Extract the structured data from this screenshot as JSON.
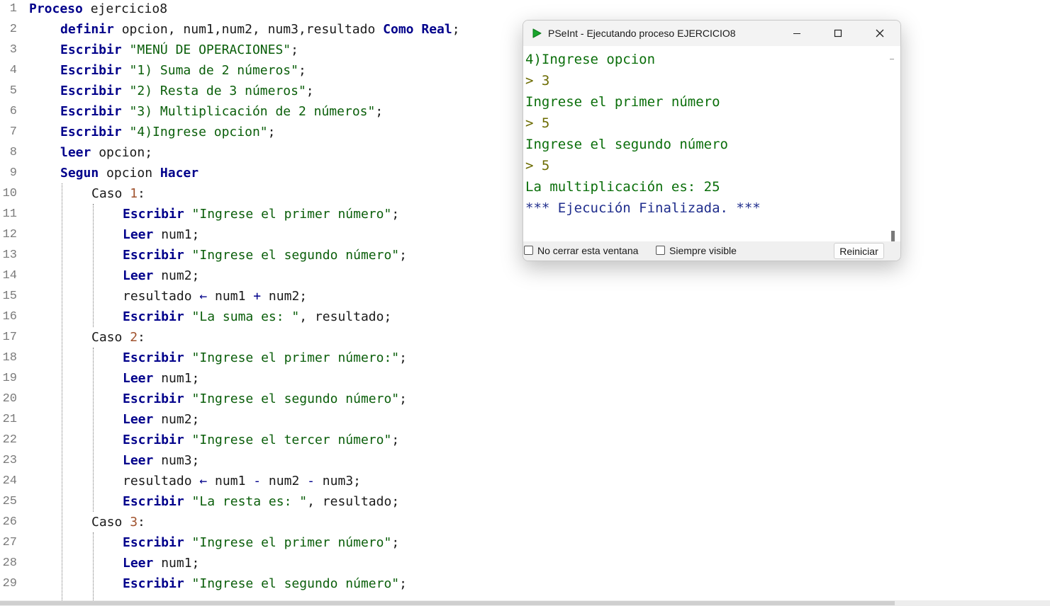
{
  "editor": {
    "lines": [
      {
        "n": "1",
        "indent": 0,
        "tokens": [
          {
            "t": "Proceso",
            "c": "kw"
          },
          {
            "t": " ejercicio8",
            "c": ""
          }
        ]
      },
      {
        "n": "2",
        "indent": 1,
        "tokens": [
          {
            "t": "definir",
            "c": "kw"
          },
          {
            "t": " opcion, num1,num2, num3,resultado ",
            "c": ""
          },
          {
            "t": "Como",
            "c": "kw"
          },
          {
            "t": " ",
            "c": ""
          },
          {
            "t": "Real",
            "c": "kw"
          },
          {
            "t": ";",
            "c": ""
          }
        ]
      },
      {
        "n": "3",
        "indent": 1,
        "tokens": [
          {
            "t": "Escribir",
            "c": "kw"
          },
          {
            "t": " ",
            "c": ""
          },
          {
            "t": "\"MENÚ DE OPERACIONES\"",
            "c": "str"
          },
          {
            "t": ";",
            "c": ""
          }
        ]
      },
      {
        "n": "4",
        "indent": 1,
        "tokens": [
          {
            "t": "Escribir",
            "c": "kw"
          },
          {
            "t": " ",
            "c": ""
          },
          {
            "t": "\"1) Suma de 2 números\"",
            "c": "str"
          },
          {
            "t": ";",
            "c": ""
          }
        ]
      },
      {
        "n": "5",
        "indent": 1,
        "tokens": [
          {
            "t": "Escribir",
            "c": "kw"
          },
          {
            "t": " ",
            "c": ""
          },
          {
            "t": "\"2) Resta de 3 números\"",
            "c": "str"
          },
          {
            "t": ";",
            "c": ""
          }
        ]
      },
      {
        "n": "6",
        "indent": 1,
        "tokens": [
          {
            "t": "Escribir",
            "c": "kw"
          },
          {
            "t": " ",
            "c": ""
          },
          {
            "t": "\"3) Multiplicación de 2 números\"",
            "c": "str"
          },
          {
            "t": ";",
            "c": ""
          }
        ]
      },
      {
        "n": "7",
        "indent": 1,
        "tokens": [
          {
            "t": "Escribir",
            "c": "kw"
          },
          {
            "t": " ",
            "c": ""
          },
          {
            "t": "\"4)Ingrese opcion\"",
            "c": "str"
          },
          {
            "t": ";",
            "c": ""
          }
        ]
      },
      {
        "n": "8",
        "indent": 1,
        "tokens": [
          {
            "t": "leer",
            "c": "kw"
          },
          {
            "t": " opcion;",
            "c": ""
          }
        ]
      },
      {
        "n": "9",
        "indent": 1,
        "tokens": [
          {
            "t": "Segun",
            "c": "kw"
          },
          {
            "t": " opcion ",
            "c": ""
          },
          {
            "t": "Hacer",
            "c": "kw"
          }
        ]
      },
      {
        "n": "10",
        "indent": 2,
        "tokens": [
          {
            "t": "Caso ",
            "c": ""
          },
          {
            "t": "1",
            "c": "num"
          },
          {
            "t": ":",
            "c": ""
          }
        ]
      },
      {
        "n": "11",
        "indent": 3,
        "tokens": [
          {
            "t": "Escribir",
            "c": "kw"
          },
          {
            "t": " ",
            "c": ""
          },
          {
            "t": "\"Ingrese el primer número\"",
            "c": "str"
          },
          {
            "t": ";",
            "c": ""
          }
        ]
      },
      {
        "n": "12",
        "indent": 3,
        "tokens": [
          {
            "t": "Leer",
            "c": "kw"
          },
          {
            "t": " num1;",
            "c": ""
          }
        ]
      },
      {
        "n": "13",
        "indent": 3,
        "tokens": [
          {
            "t": "Escribir",
            "c": "kw"
          },
          {
            "t": " ",
            "c": ""
          },
          {
            "t": "\"Ingrese el segundo número\"",
            "c": "str"
          },
          {
            "t": ";",
            "c": ""
          }
        ]
      },
      {
        "n": "14",
        "indent": 3,
        "tokens": [
          {
            "t": "Leer",
            "c": "kw"
          },
          {
            "t": " num2;",
            "c": ""
          }
        ]
      },
      {
        "n": "15",
        "indent": 3,
        "tokens": [
          {
            "t": "resultado ",
            "c": ""
          },
          {
            "t": "←",
            "c": "op"
          },
          {
            "t": " num1 ",
            "c": ""
          },
          {
            "t": "+",
            "c": "op"
          },
          {
            "t": " num2;",
            "c": ""
          }
        ]
      },
      {
        "n": "16",
        "indent": 3,
        "tokens": [
          {
            "t": "Escribir",
            "c": "kw"
          },
          {
            "t": " ",
            "c": ""
          },
          {
            "t": "\"La suma es: \"",
            "c": "str"
          },
          {
            "t": ", resultado;",
            "c": ""
          }
        ]
      },
      {
        "n": "17",
        "indent": 2,
        "tokens": [
          {
            "t": "Caso ",
            "c": ""
          },
          {
            "t": "2",
            "c": "num"
          },
          {
            "t": ":",
            "c": ""
          }
        ]
      },
      {
        "n": "18",
        "indent": 3,
        "tokens": [
          {
            "t": "Escribir",
            "c": "kw"
          },
          {
            "t": " ",
            "c": ""
          },
          {
            "t": "\"Ingrese el primer número:\"",
            "c": "str"
          },
          {
            "t": ";",
            "c": ""
          }
        ]
      },
      {
        "n": "19",
        "indent": 3,
        "tokens": [
          {
            "t": "Leer",
            "c": "kw"
          },
          {
            "t": " num1;",
            "c": ""
          }
        ]
      },
      {
        "n": "20",
        "indent": 3,
        "tokens": [
          {
            "t": "Escribir",
            "c": "kw"
          },
          {
            "t": " ",
            "c": ""
          },
          {
            "t": "\"Ingrese el segundo número\"",
            "c": "str"
          },
          {
            "t": ";",
            "c": ""
          }
        ]
      },
      {
        "n": "21",
        "indent": 3,
        "tokens": [
          {
            "t": "Leer",
            "c": "kw"
          },
          {
            "t": " num2;",
            "c": ""
          }
        ]
      },
      {
        "n": "22",
        "indent": 3,
        "tokens": [
          {
            "t": "Escribir",
            "c": "kw"
          },
          {
            "t": " ",
            "c": ""
          },
          {
            "t": "\"Ingrese el tercer número\"",
            "c": "str"
          },
          {
            "t": ";",
            "c": ""
          }
        ]
      },
      {
        "n": "23",
        "indent": 3,
        "tokens": [
          {
            "t": "Leer",
            "c": "kw"
          },
          {
            "t": " num3;",
            "c": ""
          }
        ]
      },
      {
        "n": "24",
        "indent": 3,
        "tokens": [
          {
            "t": "resultado ",
            "c": ""
          },
          {
            "t": "←",
            "c": "op"
          },
          {
            "t": " num1 ",
            "c": ""
          },
          {
            "t": "-",
            "c": "op"
          },
          {
            "t": " num2 ",
            "c": ""
          },
          {
            "t": "-",
            "c": "op"
          },
          {
            "t": " num3;",
            "c": ""
          }
        ]
      },
      {
        "n": "25",
        "indent": 3,
        "tokens": [
          {
            "t": "Escribir",
            "c": "kw"
          },
          {
            "t": " ",
            "c": ""
          },
          {
            "t": "\"La resta es: \"",
            "c": "str"
          },
          {
            "t": ", resultado;",
            "c": ""
          }
        ]
      },
      {
        "n": "26",
        "indent": 2,
        "tokens": [
          {
            "t": "Caso ",
            "c": ""
          },
          {
            "t": "3",
            "c": "num"
          },
          {
            "t": ":",
            "c": ""
          }
        ]
      },
      {
        "n": "27",
        "indent": 3,
        "tokens": [
          {
            "t": "Escribir",
            "c": "kw"
          },
          {
            "t": " ",
            "c": ""
          },
          {
            "t": "\"Ingrese el primer número\"",
            "c": "str"
          },
          {
            "t": ";",
            "c": ""
          }
        ]
      },
      {
        "n": "28",
        "indent": 3,
        "tokens": [
          {
            "t": "Leer",
            "c": "kw"
          },
          {
            "t": " num1;",
            "c": ""
          }
        ]
      },
      {
        "n": "29",
        "indent": 3,
        "tokens": [
          {
            "t": "Escribir",
            "c": "kw"
          },
          {
            "t": " ",
            "c": ""
          },
          {
            "t": "\"Ingrese el segundo número\"",
            "c": "str"
          },
          {
            "t": ";",
            "c": ""
          }
        ]
      }
    ]
  },
  "run_window": {
    "title": "PSeInt - Ejecutando proceso EJERCICIO8",
    "console": [
      {
        "text": "4)Ingrese opcion",
        "kind": "out"
      },
      {
        "text": "> 3",
        "kind": "inp"
      },
      {
        "text": "Ingrese el primer número",
        "kind": "out"
      },
      {
        "text": "> 5",
        "kind": "inp"
      },
      {
        "text": "Ingrese el segundo número",
        "kind": "out"
      },
      {
        "text": "> 5",
        "kind": "inp"
      },
      {
        "text": "La multiplicación es: 25",
        "kind": "out"
      },
      {
        "text": "*** Ejecución Finalizada. ***",
        "kind": "fin"
      }
    ],
    "no_close_label": "No cerrar esta ventana",
    "always_visible_label": "Siempre visible",
    "restart_label": "Reiniciar",
    "icons": {
      "app": "pseint-play-icon",
      "minimize": "minimize-icon",
      "maximize": "maximize-icon",
      "close": "close-icon"
    }
  },
  "colors": {
    "keyword": "#00008b",
    "string": "#0a5e0a",
    "number": "#a0522d",
    "console_output": "#0a6e0a",
    "console_input": "#6b6b00",
    "console_final": "#1f2d8c"
  }
}
